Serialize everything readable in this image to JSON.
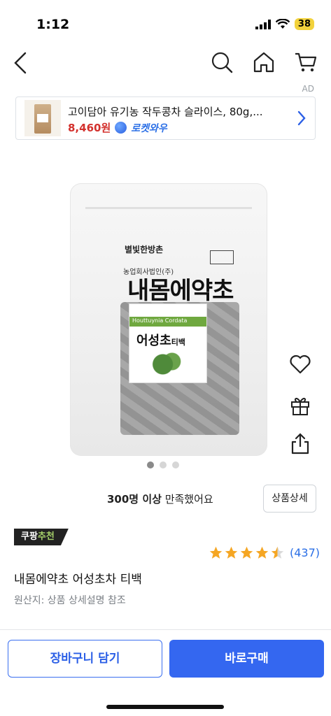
{
  "status_bar": {
    "time": "1:12",
    "battery": "38"
  },
  "ad": {
    "label": "AD",
    "title": "고이담아 유기농 작두콩차 슬라이스, 80g,...",
    "price": "8,460원",
    "rocket_label": "로켓와우"
  },
  "product_image": {
    "brand": "별빛한방촌",
    "sub_brand": "농업회사법인(주)",
    "package_title": "내몸에약초",
    "label_band": "Houttuynia Cordata",
    "label_name": "어성초",
    "label_suffix": "티백"
  },
  "carousel": {
    "count": 3,
    "active": 0
  },
  "satisfaction": {
    "count_text": "300명 이상",
    "suffix": " 만족했어요"
  },
  "detail_button": "상품상세",
  "recommend_badge": {
    "prefix": "쿠팡",
    "highlight": "추천"
  },
  "rating": {
    "stars": 4.5,
    "review_count": "(437)"
  },
  "product": {
    "name": "내몸에약초 어성초차 티백",
    "origin": "원산지: 상품 상세설명 참조"
  },
  "buttons": {
    "cart": "장바구니 담기",
    "buy": "바로구매"
  },
  "icons": {
    "back": "chevron-left-icon",
    "search": "search-icon",
    "home": "home-icon",
    "cart": "cart-icon",
    "heart": "heart-icon",
    "gift": "gift-icon",
    "share": "share-icon"
  },
  "colors": {
    "accent": "#3467f0",
    "price": "#d3312d",
    "star": "#f5a623",
    "rocket": "#2b6fe6"
  }
}
